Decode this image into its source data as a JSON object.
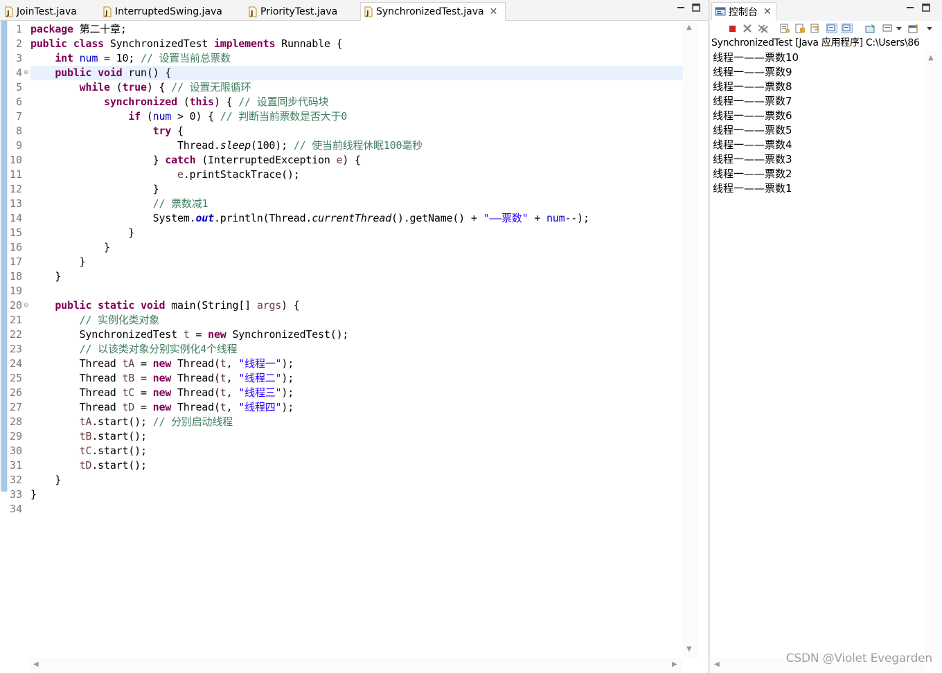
{
  "editor": {
    "tabs": [
      {
        "label": "JoinTest.java",
        "active": false
      },
      {
        "label": "InterruptedSwing.java",
        "active": false
      },
      {
        "label": "PriorityTest.java",
        "active": false
      },
      {
        "label": "SynchronizedTest.java",
        "active": true
      }
    ],
    "current_line": 4,
    "fold_markers": [
      4,
      20
    ],
    "lines": [
      [
        [
          "kw",
          "package"
        ],
        [
          "pl",
          " 第二十章;"
        ]
      ],
      [
        [
          "kw",
          "public"
        ],
        [
          "pl",
          " "
        ],
        [
          "kw",
          "class"
        ],
        [
          "pl",
          " SynchronizedTest "
        ],
        [
          "kw",
          "implements"
        ],
        [
          "pl",
          " Runnable {"
        ]
      ],
      [
        [
          "pl",
          "    "
        ],
        [
          "kw",
          "int"
        ],
        [
          "pl",
          " "
        ],
        [
          "fd",
          "num"
        ],
        [
          "pl",
          " = 10; "
        ],
        [
          "cm",
          "// 设置当前总票数"
        ]
      ],
      [
        [
          "pl",
          "    "
        ],
        [
          "kw",
          "public"
        ],
        [
          "pl",
          " "
        ],
        [
          "kw",
          "void"
        ],
        [
          "pl",
          " run() {"
        ]
      ],
      [
        [
          "pl",
          "        "
        ],
        [
          "kw",
          "while"
        ],
        [
          "pl",
          " ("
        ],
        [
          "kw",
          "true"
        ],
        [
          "pl",
          ") { "
        ],
        [
          "cm",
          "// 设置无限循环"
        ]
      ],
      [
        [
          "pl",
          "            "
        ],
        [
          "kw",
          "synchronized"
        ],
        [
          "pl",
          " ("
        ],
        [
          "kw",
          "this"
        ],
        [
          "pl",
          ") { "
        ],
        [
          "cm",
          "// 设置同步代码块"
        ]
      ],
      [
        [
          "pl",
          "                "
        ],
        [
          "kw",
          "if"
        ],
        [
          "pl",
          " ("
        ],
        [
          "fd",
          "num"
        ],
        [
          "pl",
          " > 0) { "
        ],
        [
          "cm",
          "// 判断当前票数是否大于0"
        ]
      ],
      [
        [
          "pl",
          "                    "
        ],
        [
          "kw",
          "try"
        ],
        [
          "pl",
          " {"
        ]
      ],
      [
        [
          "pl",
          "                        Thread."
        ],
        [
          "it",
          "sleep"
        ],
        [
          "pl",
          "(100); "
        ],
        [
          "cm",
          "// 使当前线程休眠100毫秒"
        ]
      ],
      [
        [
          "pl",
          "                    } "
        ],
        [
          "kw",
          "catch"
        ],
        [
          "pl",
          " (InterruptedException "
        ],
        [
          "var",
          "e"
        ],
        [
          "pl",
          ") {"
        ]
      ],
      [
        [
          "pl",
          "                        "
        ],
        [
          "var",
          "e"
        ],
        [
          "pl",
          ".printStackTrace();"
        ]
      ],
      [
        [
          "pl",
          "                    }"
        ]
      ],
      [
        [
          "pl",
          "                    "
        ],
        [
          "cm",
          "// 票数减1"
        ]
      ],
      [
        [
          "pl",
          "                    System."
        ],
        [
          "fdb",
          "out"
        ],
        [
          "pl",
          ".println(Thread."
        ],
        [
          "it",
          "currentThread"
        ],
        [
          "pl",
          "().getName() + "
        ],
        [
          "st",
          "\"——票数\""
        ],
        [
          "pl",
          " + "
        ],
        [
          "fd",
          "num"
        ],
        [
          "pl",
          "--);"
        ]
      ],
      [
        [
          "pl",
          "                }"
        ]
      ],
      [
        [
          "pl",
          "            }"
        ]
      ],
      [
        [
          "pl",
          "        }"
        ]
      ],
      [
        [
          "pl",
          "    }"
        ]
      ],
      [],
      [
        [
          "pl",
          "    "
        ],
        [
          "kw",
          "public"
        ],
        [
          "pl",
          " "
        ],
        [
          "kw",
          "static"
        ],
        [
          "pl",
          " "
        ],
        [
          "kw",
          "void"
        ],
        [
          "pl",
          " main(String[] "
        ],
        [
          "var",
          "args"
        ],
        [
          "pl",
          ") {"
        ]
      ],
      [
        [
          "pl",
          "        "
        ],
        [
          "cm",
          "// 实例化类对象"
        ]
      ],
      [
        [
          "pl",
          "        SynchronizedTest "
        ],
        [
          "var",
          "t"
        ],
        [
          "pl",
          " = "
        ],
        [
          "kw",
          "new"
        ],
        [
          "pl",
          " SynchronizedTest();"
        ]
      ],
      [
        [
          "pl",
          "        "
        ],
        [
          "cm",
          "// 以该类对象分别实例化4个线程"
        ]
      ],
      [
        [
          "pl",
          "        Thread "
        ],
        [
          "var",
          "tA"
        ],
        [
          "pl",
          " = "
        ],
        [
          "kw",
          "new"
        ],
        [
          "pl",
          " Thread("
        ],
        [
          "var",
          "t"
        ],
        [
          "pl",
          ", "
        ],
        [
          "st",
          "\"线程一\""
        ],
        [
          "pl",
          ");"
        ]
      ],
      [
        [
          "pl",
          "        Thread "
        ],
        [
          "var",
          "tB"
        ],
        [
          "pl",
          " = "
        ],
        [
          "kw",
          "new"
        ],
        [
          "pl",
          " Thread("
        ],
        [
          "var",
          "t"
        ],
        [
          "pl",
          ", "
        ],
        [
          "st",
          "\"线程二\""
        ],
        [
          "pl",
          ");"
        ]
      ],
      [
        [
          "pl",
          "        Thread "
        ],
        [
          "var",
          "tC"
        ],
        [
          "pl",
          " = "
        ],
        [
          "kw",
          "new"
        ],
        [
          "pl",
          " Thread("
        ],
        [
          "var",
          "t"
        ],
        [
          "pl",
          ", "
        ],
        [
          "st",
          "\"线程三\""
        ],
        [
          "pl",
          ");"
        ]
      ],
      [
        [
          "pl",
          "        Thread "
        ],
        [
          "var",
          "tD"
        ],
        [
          "pl",
          " = "
        ],
        [
          "kw",
          "new"
        ],
        [
          "pl",
          " Thread("
        ],
        [
          "var",
          "t"
        ],
        [
          "pl",
          ", "
        ],
        [
          "st",
          "\"线程四\""
        ],
        [
          "pl",
          ");"
        ]
      ],
      [
        [
          "pl",
          "        "
        ],
        [
          "var",
          "tA"
        ],
        [
          "pl",
          ".start(); "
        ],
        [
          "cm",
          "// 分别启动线程"
        ]
      ],
      [
        [
          "pl",
          "        "
        ],
        [
          "var",
          "tB"
        ],
        [
          "pl",
          ".start();"
        ]
      ],
      [
        [
          "pl",
          "        "
        ],
        [
          "var",
          "tC"
        ],
        [
          "pl",
          ".start();"
        ]
      ],
      [
        [
          "pl",
          "        "
        ],
        [
          "var",
          "tD"
        ],
        [
          "pl",
          ".start();"
        ]
      ],
      [
        [
          "pl",
          "    }"
        ]
      ],
      [
        [
          "pl",
          "}"
        ]
      ],
      []
    ]
  },
  "console": {
    "tab_label": "控制台",
    "header": "SynchronizedTest [Java 应用程序] C:\\Users\\86",
    "output": [
      "线程一——票数10",
      "线程一——票数9",
      "线程一——票数8",
      "线程一——票数7",
      "线程一——票数6",
      "线程一——票数5",
      "线程一——票数4",
      "线程一——票数3",
      "线程一——票数2",
      "线程一——票数1"
    ],
    "toolbar_icons": [
      "terminate-icon",
      "remove-launch-icon",
      "remove-all-terminated-icon",
      "clear-console-icon",
      "scroll-lock-icon",
      "word-wrap-icon",
      "show-on-stdout-icon",
      "show-on-stderr-icon",
      "pin-console-icon",
      "display-selected-console-icon",
      "display-dropdown-icon",
      "open-console-icon",
      "open-dropdown-icon"
    ]
  },
  "watermark": "CSDN @Violet Evegarden",
  "colors": {
    "keyword": "#7f0055",
    "comment": "#3f7f5f",
    "string": "#2a00ff",
    "field": "#0000c0",
    "local_var": "#6a3e3e",
    "current_line": "#e8f2fe"
  }
}
